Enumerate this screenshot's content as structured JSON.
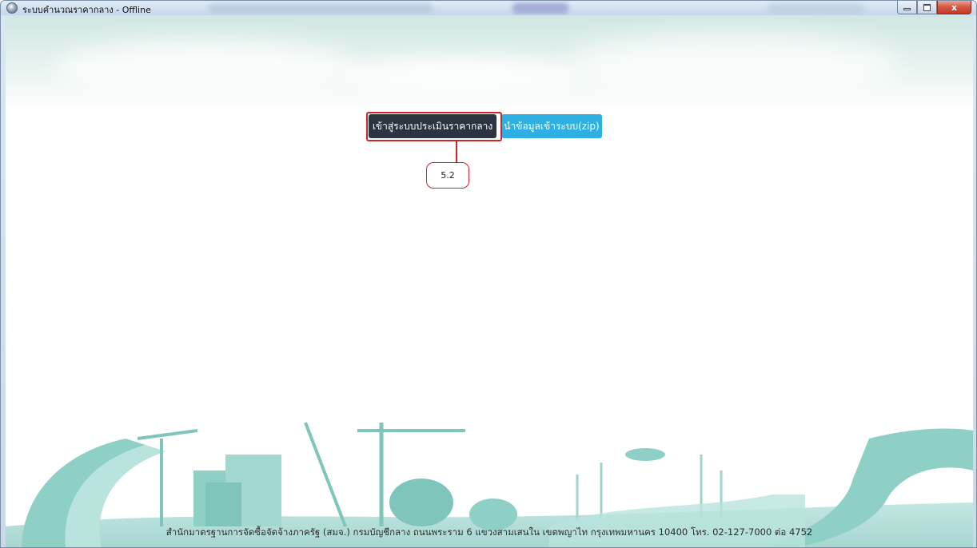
{
  "window": {
    "title": "ระบบคำนวณราคากลาง - Offline",
    "close_glyph": "x"
  },
  "main": {
    "buttons": [
      {
        "label": "เข้าสู่ระบบประเมินราคากลาง",
        "color": "#2c3440"
      },
      {
        "label": "นำข้อมูลเข้าระบบ(zip)",
        "color": "#2fb0e2"
      }
    ]
  },
  "annotation": {
    "label": "5.2",
    "color": "#d2232a"
  },
  "footer": {
    "text": "สำนักมาตรฐานการจัดซื้อจัดจ้างภาครัฐ (สมจ.) กรมบัญชีกลาง ถนนพระราม 6 แขวงสามเสนใน เขตพญาไท กรุงเทพมหานคร 10400 โทร. 02-127-7000 ต่อ 4752"
  },
  "theme": {
    "scenery_color": "#9fd3cc"
  }
}
